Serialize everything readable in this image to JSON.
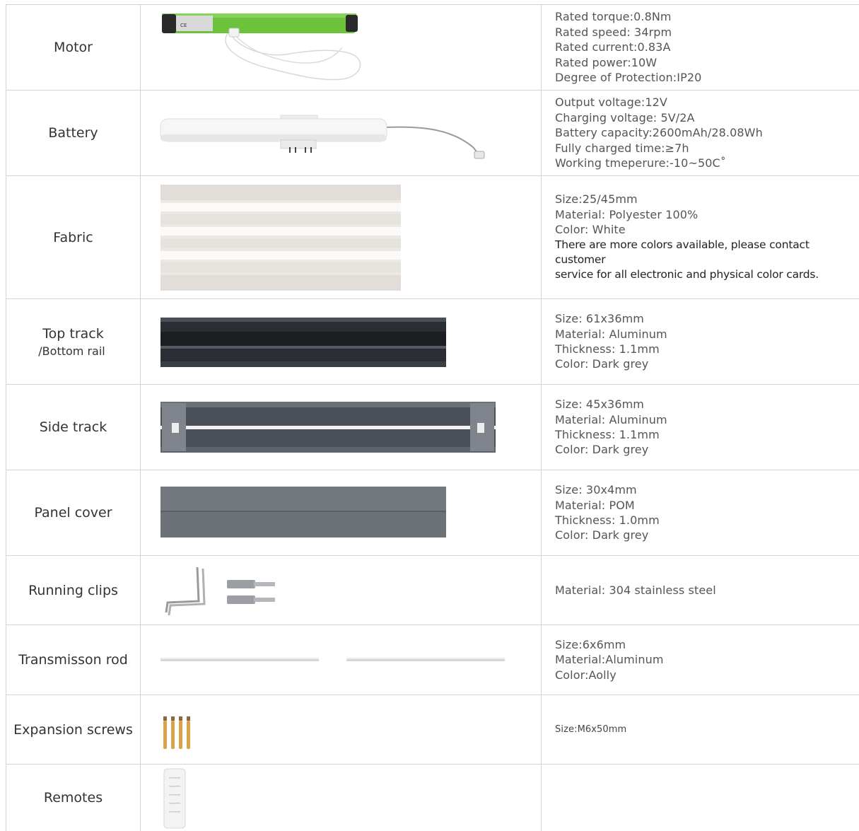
{
  "rows": [
    {
      "name": "Motor",
      "specs": [
        "Rated torque:0.8Nm",
        "Rated speed: 34rpm",
        "Rated current:0.83A",
        "Rated power:10W",
        "Degree of Protection:IP20"
      ]
    },
    {
      "name": "Battery",
      "specs": [
        "Output voltage:12V",
        "Charging voltage: 5V/2A",
        "Battery capacity:2600mAh/28.08Wh",
        "Fully charged time:≥7h",
        "Working tmeperure:-10~50C˚"
      ]
    },
    {
      "name": "Fabric",
      "specs": [
        "Size:25/45mm",
        "Material: Polyester 100%",
        "Color: White"
      ],
      "note": [
        "There are more colors available, please contact customer",
        "service for all electronic and physical color cards."
      ]
    },
    {
      "name": "Top track",
      "subname": "/Bottom rail",
      "specs": [
        "Size: 61x36mm",
        "Material: Aluminum",
        "Thickness: 1.1mm",
        "Color: Dark grey"
      ]
    },
    {
      "name": "Side track",
      "specs": [
        "Size: 45x36mm",
        "Material: Aluminum",
        "Thickness: 1.1mm",
        "Color: Dark grey"
      ]
    },
    {
      "name": "Panel cover",
      "specs": [
        "Size: 30x4mm",
        "Material: POM",
        "Thickness: 1.0mm",
        "Color: Dark grey"
      ]
    },
    {
      "name": "Running clips",
      "specs": [
        "Material: 304 stainless steel"
      ]
    },
    {
      "name": "Transmisson rod",
      "specs": [
        "Size:6x6mm",
        "Material:Aluminum",
        "Color:Aolly"
      ]
    },
    {
      "name": "Expansion screws",
      "specs": [
        "Size:M6x50mm"
      ]
    },
    {
      "name": "Remotes",
      "specs": []
    }
  ],
  "motor_label": "CE"
}
